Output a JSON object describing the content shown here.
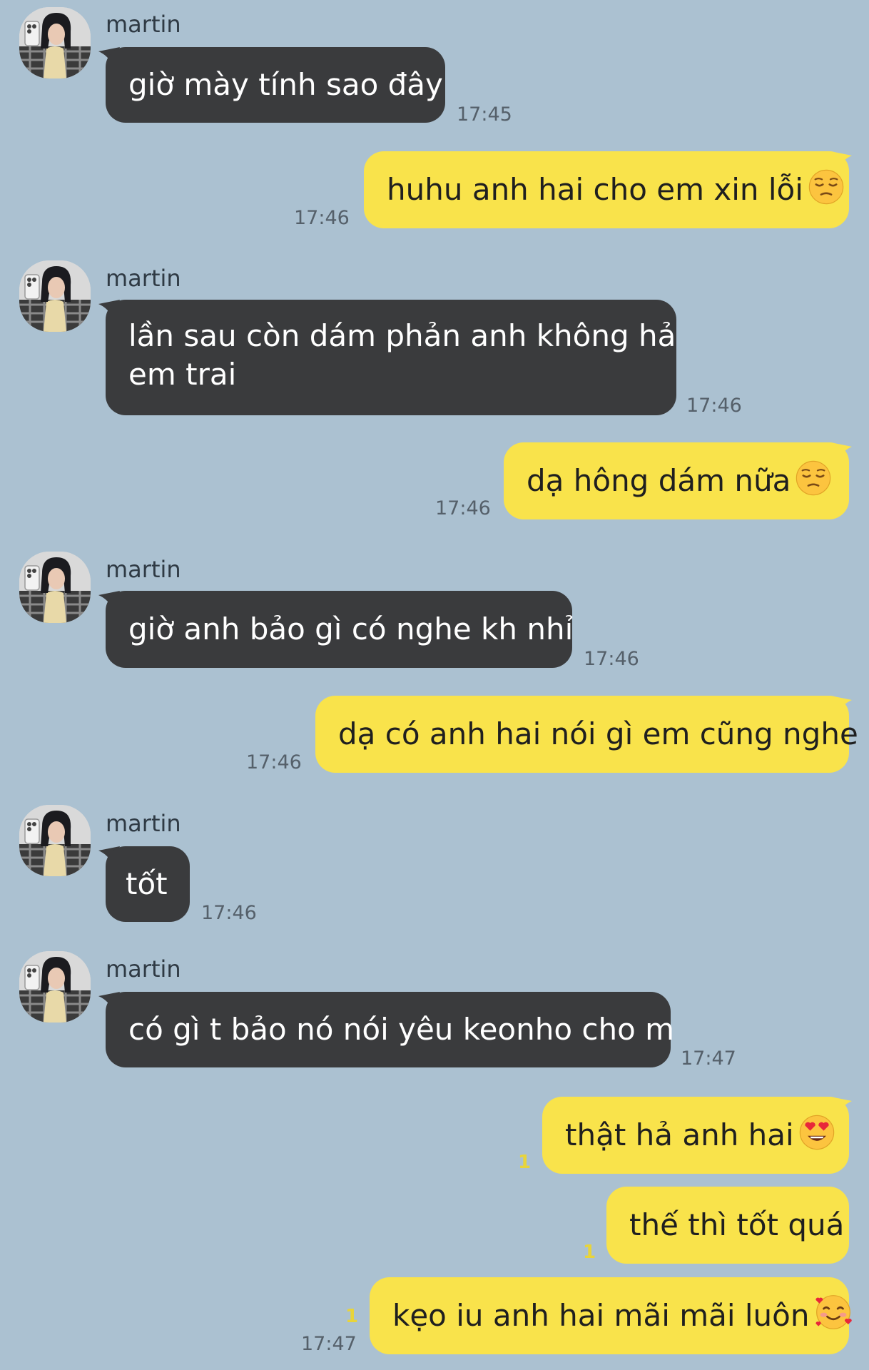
{
  "chat": {
    "sender_name": "martin",
    "messages": [
      {
        "text": "giờ mày tính sao đây",
        "time": "17:45"
      },
      {
        "text": "huhu anh hai cho em xin lỗi",
        "emoji": "pensive-face",
        "time": "17:46"
      },
      {
        "line1": "lần sau còn dám phản anh không hả",
        "line2": "em trai",
        "time": "17:46"
      },
      {
        "text": "dạ hông dám nữa",
        "emoji": "pensive-face",
        "time": "17:46"
      },
      {
        "text": "giờ anh bảo gì có nghe kh nhỉ",
        "time": "17:46"
      },
      {
        "text": "dạ có anh hai nói gì em cũng nghe",
        "time": "17:46"
      },
      {
        "text": "tốt",
        "time": "17:46"
      },
      {
        "text": "có gì t bảo nó nói yêu keonho cho m",
        "time": "17:47"
      },
      {
        "text": "thật hả anh hai",
        "emoji": "heart-eyes-face",
        "unread": "1"
      },
      {
        "text": "thế thì tốt quá",
        "unread": "1"
      },
      {
        "text": "kẹo iu anh hai mãi mãi luôn",
        "emoji": "smiling-face-with-hearts",
        "unread": "1",
        "time": "17:47"
      }
    ]
  },
  "colors": {
    "background": "#abc1d1",
    "incoming_bubble": "#3a3b3d",
    "outgoing_bubble": "#f9e34b",
    "unread_count": "#e8d43a"
  }
}
